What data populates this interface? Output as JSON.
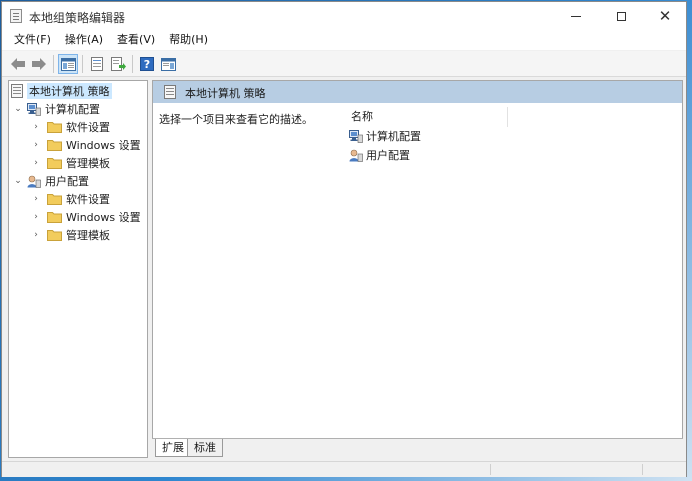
{
  "window": {
    "title": "本地组策略编辑器"
  },
  "menu": [
    {
      "label": "文件(F)"
    },
    {
      "label": "操作(A)"
    },
    {
      "label": "查看(V)"
    },
    {
      "label": "帮助(H)"
    }
  ],
  "toolbar": {
    "icons": [
      "back-arrow-icon",
      "forward-arrow-icon",
      "show-tree-icon",
      "properties-icon",
      "export-list-icon",
      "help-icon",
      "action-pane-icon"
    ]
  },
  "tree": {
    "root": "本地计算机 策略",
    "computer_config": "计算机配置",
    "user_config": "用户配置",
    "software_settings": "软件设置",
    "windows_settings": "Windows 设置",
    "admin_templates": "管理模板"
  },
  "details": {
    "header_title": "本地计算机 策略",
    "description": "选择一个项目来查看它的描述。",
    "column_name": "名称",
    "items": [
      {
        "label": "计算机配置"
      },
      {
        "label": "用户配置"
      }
    ]
  },
  "tabs": {
    "extended": "扩展",
    "standard": "标准"
  },
  "colors": {
    "header_bg": "#b7cde3",
    "selection": "#cce8ff",
    "folder": "#f2cc5c"
  }
}
